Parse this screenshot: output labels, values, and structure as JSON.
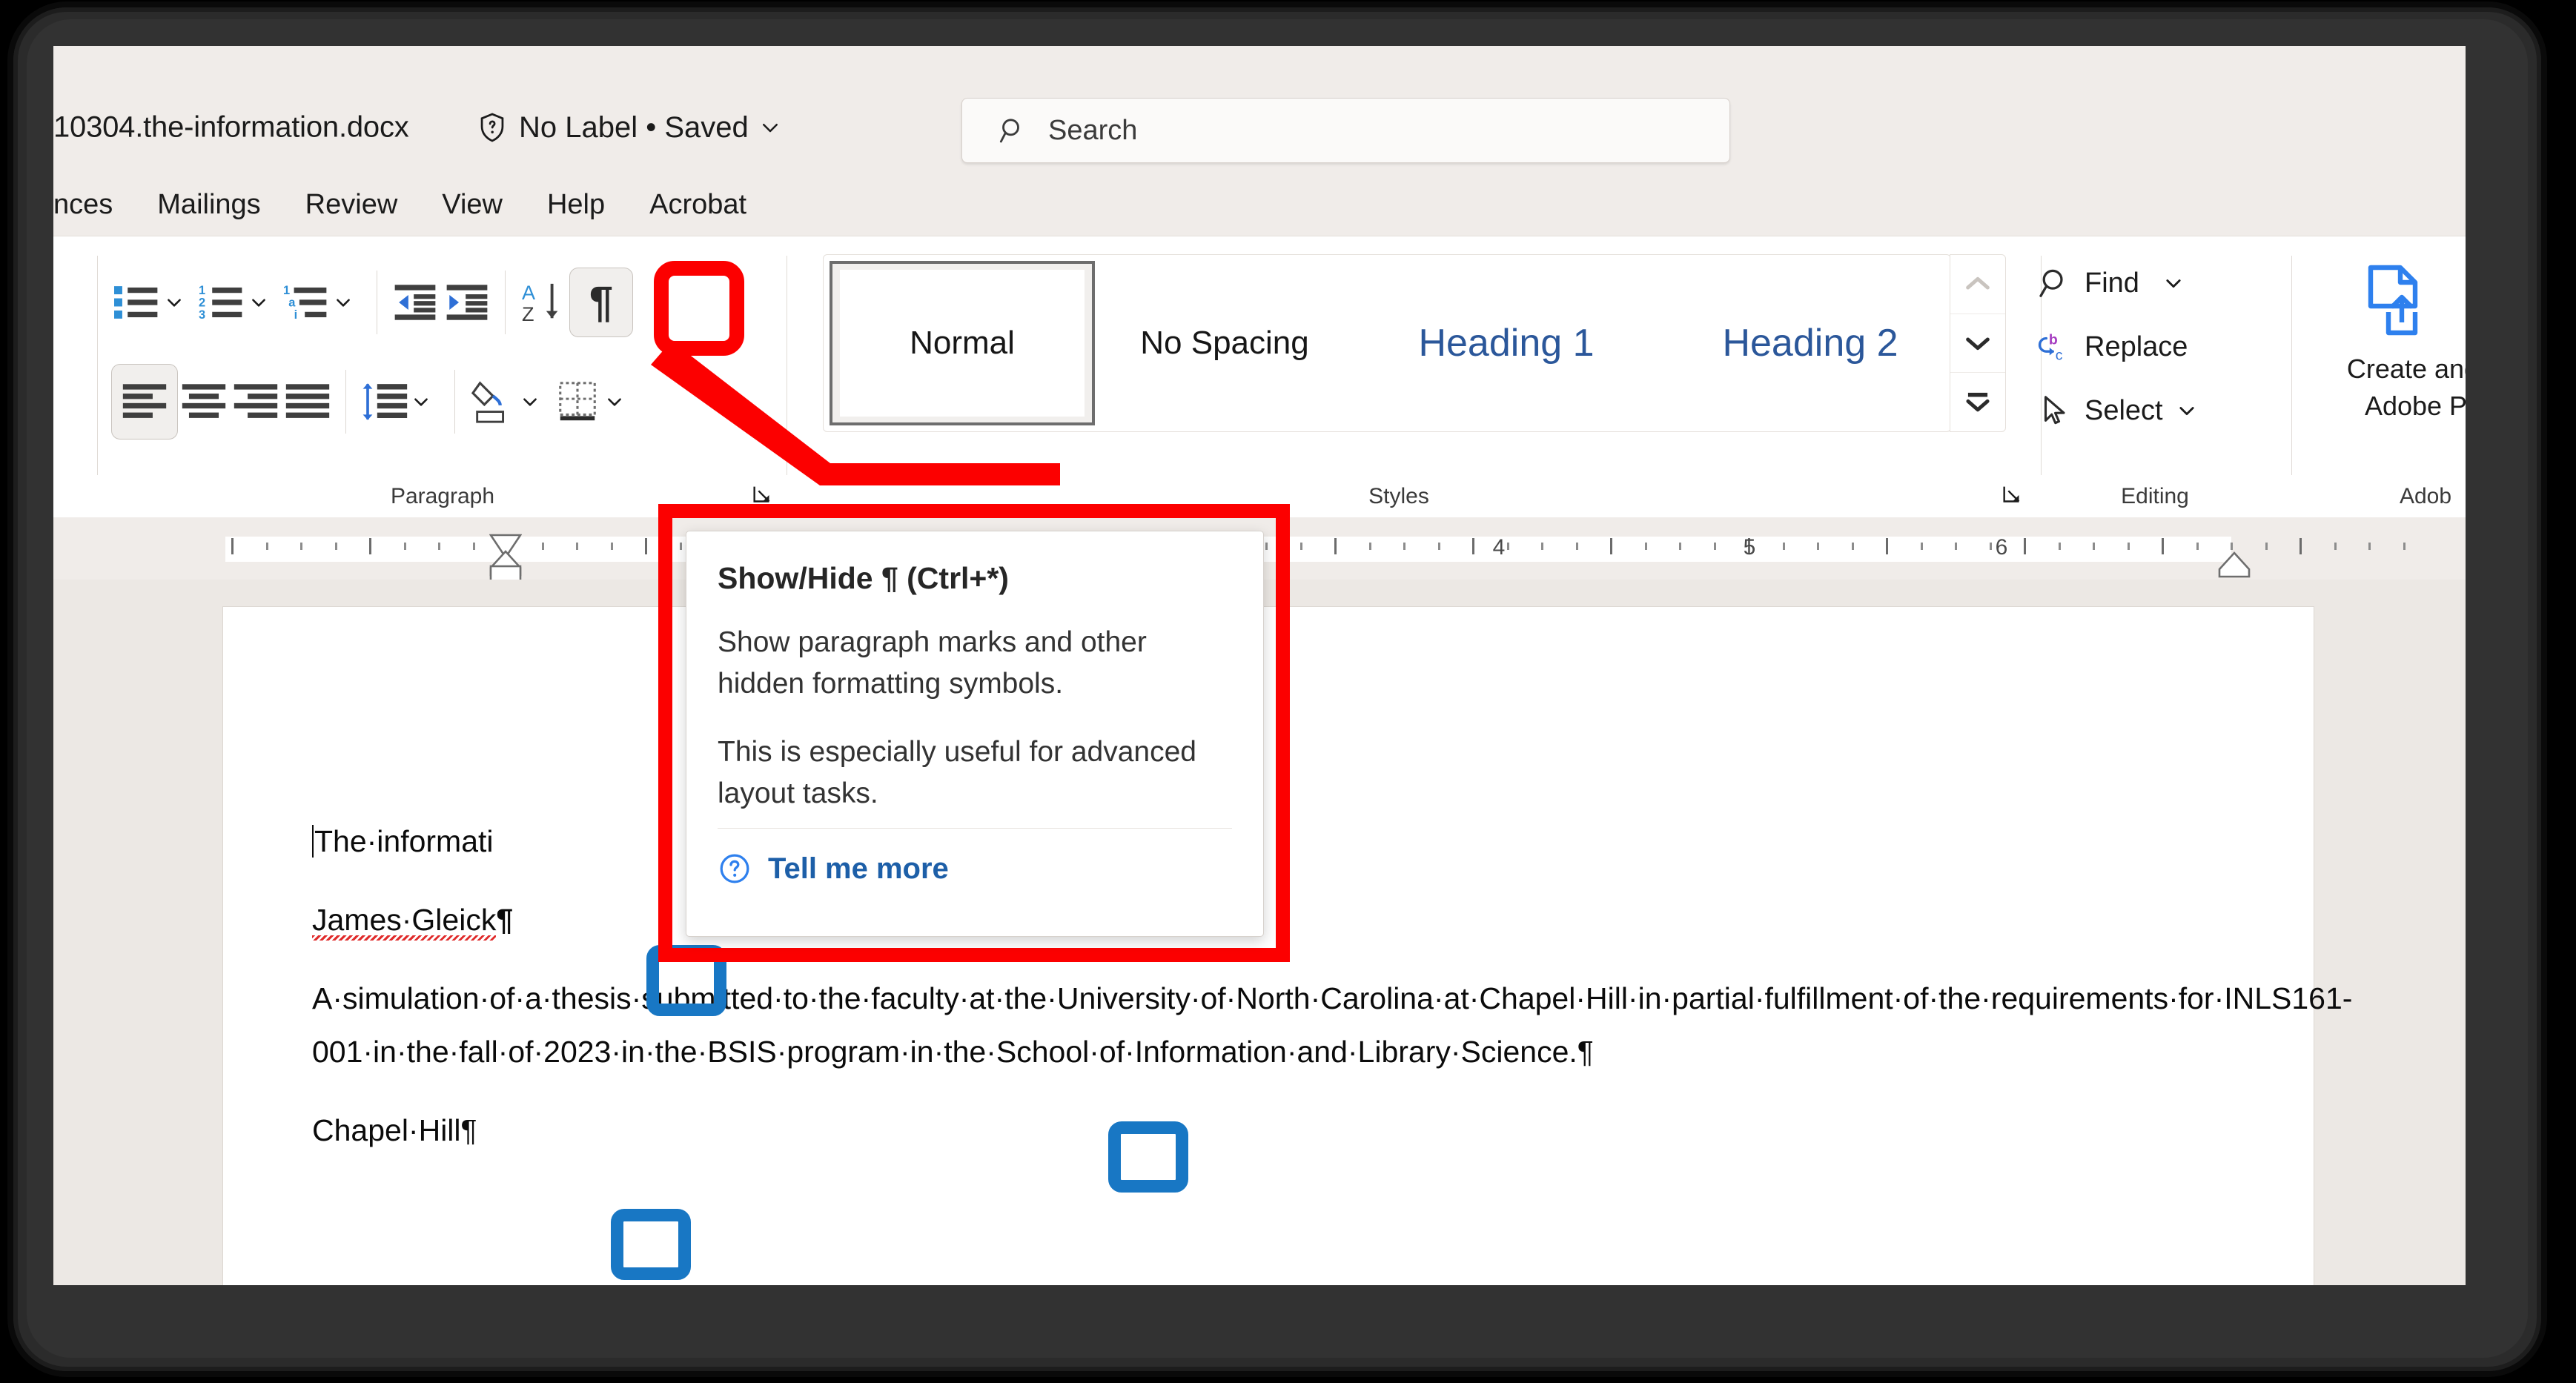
{
  "window": {
    "title_bar": {
      "document_name": "10304.the-information.docx",
      "sensitivity_icon": "shield-question-icon",
      "sensitivity_label": "No Label • Saved",
      "sensitivity_chevron": "chevron-down-icon"
    },
    "search": {
      "icon": "search-icon",
      "placeholder": "Search"
    }
  },
  "ribbon_tabs": [
    {
      "label": "nces"
    },
    {
      "label": "Mailings"
    },
    {
      "label": "Review"
    },
    {
      "label": "View"
    },
    {
      "label": "Help"
    },
    {
      "label": "Acrobat"
    }
  ],
  "ribbon": {
    "groups": {
      "font": {
        "label": "",
        "dialog_launcher": "dialog-launcher-icon"
      },
      "paragraph": {
        "label": "Paragraph",
        "dialog_launcher": "dialog-launcher-icon",
        "row1": [
          {
            "name": "bullets-button",
            "icon": "bullet-list-icon",
            "has_chevron": true
          },
          {
            "name": "numbering-button",
            "icon": "numbered-list-icon",
            "has_chevron": true
          },
          {
            "name": "multilevel-list-button",
            "icon": "multilevel-list-icon",
            "has_chevron": true
          },
          {
            "name": "decrease-indent-button",
            "icon": "decrease-indent-icon",
            "has_chevron": false
          },
          {
            "name": "increase-indent-button",
            "icon": "increase-indent-icon",
            "has_chevron": false
          },
          {
            "name": "sort-button",
            "icon": "sort-az-icon",
            "has_chevron": false
          },
          {
            "name": "show-hide-paragraph-marks-button",
            "icon": "pilcrow-icon",
            "has_chevron": false,
            "selected": true,
            "highlighted": true
          }
        ],
        "row2": [
          {
            "name": "align-left-button",
            "icon": "align-left-icon",
            "selected": true
          },
          {
            "name": "align-center-button",
            "icon": "align-center-icon"
          },
          {
            "name": "align-right-button",
            "icon": "align-right-icon"
          },
          {
            "name": "justify-button",
            "icon": "justify-icon"
          },
          {
            "name": "line-spacing-button",
            "icon": "line-spacing-icon",
            "has_chevron": true
          },
          {
            "name": "shading-button",
            "icon": "shading-icon",
            "has_chevron": true
          },
          {
            "name": "borders-button",
            "icon": "borders-icon",
            "has_chevron": true
          }
        ]
      },
      "styles": {
        "label": "Styles",
        "dialog_launcher": "dialog-launcher-icon",
        "items": [
          {
            "label": "Normal",
            "selected": true
          },
          {
            "label": "No Spacing",
            "selected": false
          },
          {
            "label": "Heading 1",
            "selected": false,
            "accent": true
          },
          {
            "label": "Heading 2",
            "selected": false,
            "accent": true
          }
        ],
        "scroll_buttons": [
          {
            "name": "styles-scroll-up-button",
            "icon": "chevron-up-icon",
            "disabled": true
          },
          {
            "name": "styles-scroll-down-button",
            "icon": "chevron-down-icon",
            "disabled": false
          },
          {
            "name": "styles-more-button",
            "icon": "more-styles-icon",
            "disabled": false
          }
        ]
      },
      "editing": {
        "label": "Editing",
        "items": [
          {
            "label": "Find",
            "icon": "search-icon",
            "has_chevron": true
          },
          {
            "label": "Replace",
            "icon": "replace-icon",
            "has_chevron": false
          },
          {
            "label": "Select",
            "icon": "cursor-arrow-icon",
            "has_chevron": true
          }
        ]
      },
      "adobe": {
        "label": "Adob",
        "button_icon": "create-pdf-icon",
        "button_line1": "Create and S",
        "button_line2": "Adobe PD"
      }
    }
  },
  "ruler": {
    "numbers": [
      "4",
      "5",
      "6"
    ],
    "markers": [
      "first-line-indent-marker",
      "hanging-indent-marker",
      "left-indent-marker",
      "right-indent-marker"
    ]
  },
  "document": {
    "paragraphs": [
      {
        "text": "The·informati",
        "clipped": true,
        "has_caret": true
      },
      {
        "text": "James·Gleick¶",
        "misspelled": "James·Gleick",
        "pilcrow": true
      },
      {
        "text": "A·simulation·of·a·thesis·submitted·to·the·faculty·at·the·University·of·North·Carolina·at·Chapel·Hill·in·partial·fulfillment·of·the·requirements·for·INLS161-001·in·the·fall·of·2023·in·the·BSIS·program·in·the·School·of·Information·and·Library·Science.¶"
      },
      {
        "text": "Chapel·Hill¶",
        "pilcrow": true
      }
    ]
  },
  "tooltip": {
    "title": "Show/Hide ¶ (Ctrl+*)",
    "body1": "Show paragraph marks and other hidden formatting symbols.",
    "body2": "This is especially useful for advanced layout tasks.",
    "link_icon": "help-circle-icon",
    "link_label": "Tell me more"
  },
  "annotations": {
    "highlight_color": "#fc0000",
    "marker_color": "#1877c4",
    "red_highlights": [
      "show-hide-paragraph-marks-button",
      "tooltip-callout"
    ],
    "blue_highlights": [
      "pilcrow-after-gleick",
      "pilcrow-after-science",
      "pilcrow-after-chapel-hill"
    ]
  },
  "colors": {
    "app_chrome": "#f0ece9",
    "ribbon_bg": "#ffffff",
    "accent_blue": "#2b579a",
    "link_blue": "#1d5fa8",
    "canvas": "#ece8e4"
  }
}
